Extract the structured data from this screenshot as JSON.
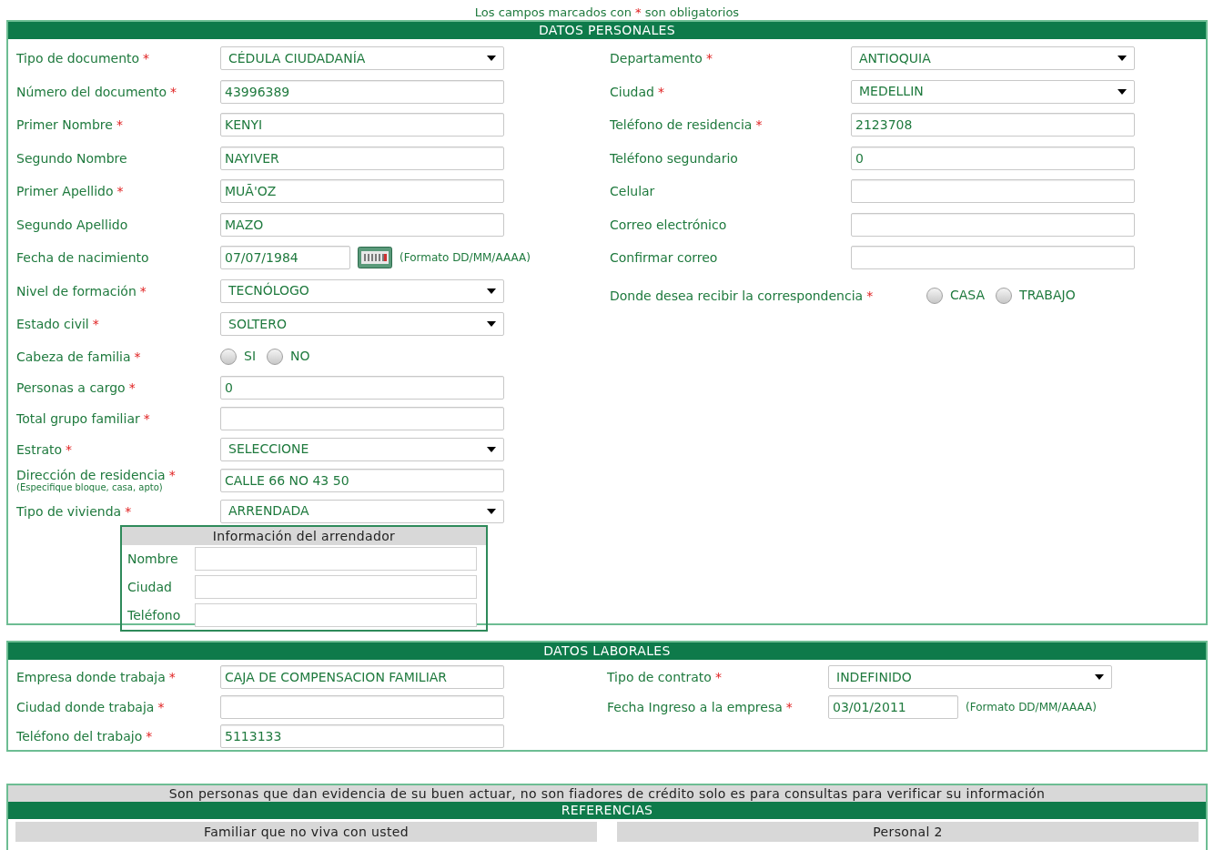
{
  "required_note": {
    "before": "Los campos marcados con",
    "mark": "*",
    "after": "son obligatorios"
  },
  "personal": {
    "title": "DATOS PERSONALES",
    "left": [
      {
        "label": "Tipo de documento",
        "required": true,
        "kind": "select",
        "value": "CÉDULA CIUDADANÍA"
      },
      {
        "label": "Número del documento",
        "required": true,
        "kind": "text",
        "value": "43996389"
      },
      {
        "label": "Primer Nombre",
        "required": true,
        "kind": "text",
        "value": "KENYI"
      },
      {
        "label": "Segundo Nombre",
        "required": false,
        "kind": "text",
        "value": "NAYIVER"
      },
      {
        "label": "Primer Apellido",
        "required": true,
        "kind": "text",
        "value": "MUÃ'OZ"
      },
      {
        "label": "Segundo Apellido",
        "required": false,
        "kind": "text",
        "value": "MAZO"
      },
      {
        "label": "Fecha de nacimiento",
        "required": false,
        "kind": "date",
        "value": "07/07/1984",
        "hint": "(Formato DD/MM/AAAA)"
      },
      {
        "label": "Nivel de formación",
        "required": true,
        "kind": "select",
        "value": "TECNÓLOGO"
      },
      {
        "label": "Estado civil",
        "required": true,
        "kind": "select",
        "value": "SOLTERO"
      },
      {
        "label": "Cabeza de familia",
        "required": true,
        "kind": "radio",
        "options": [
          {
            "label": "SI",
            "selected": false
          },
          {
            "label": "NO",
            "selected": false
          }
        ]
      },
      {
        "label": "Personas a cargo",
        "required": true,
        "kind": "text",
        "value": "0"
      },
      {
        "label": "Total grupo familiar",
        "required": true,
        "kind": "text"
      },
      {
        "label": "Estrato",
        "required": true,
        "kind": "select",
        "value": "SELECCIONE"
      },
      {
        "label": "Dirección de residencia",
        "required": true,
        "kind": "text",
        "value": "CALLE 66 NO 43 50",
        "sublabel": "(Especifique bloque, casa, apto)"
      },
      {
        "label": "Tipo de vivienda",
        "required": true,
        "kind": "select",
        "value": "ARRENDADA"
      }
    ],
    "landlord": {
      "title": "Información del arrendador",
      "fields": [
        {
          "label": "Nombre"
        },
        {
          "label": "Ciudad"
        },
        {
          "label": "Teléfono"
        }
      ]
    },
    "right": [
      {
        "label": "Departamento",
        "required": true,
        "kind": "select",
        "value": "ANTIOQUIA"
      },
      {
        "label": "Ciudad",
        "required": true,
        "kind": "select",
        "value": "MEDELLIN"
      },
      {
        "label": "Teléfono de residencia",
        "required": true,
        "kind": "text",
        "value": "2123708"
      },
      {
        "label": "Teléfono segundario",
        "required": false,
        "kind": "text",
        "value": "0"
      },
      {
        "label": "Celular",
        "required": false,
        "kind": "text"
      },
      {
        "label": "Correo electrónico",
        "required": false,
        "kind": "text"
      },
      {
        "label": "Confirmar correo",
        "required": false,
        "kind": "text"
      },
      {
        "label": "Donde desea recibir la correspondencia",
        "required": true,
        "kind": "radio",
        "options": [
          {
            "label": "CASA",
            "selected": false
          },
          {
            "label": "TRABAJO",
            "selected": false
          }
        ]
      }
    ]
  },
  "laboral": {
    "title": "DATOS LABORALES",
    "left": [
      {
        "label": "Empresa donde trabaja",
        "required": true,
        "kind": "text",
        "value": "CAJA DE COMPENSACION FAMILIAR"
      },
      {
        "label": "Ciudad donde trabaja",
        "required": true,
        "kind": "text"
      },
      {
        "label": "Teléfono del trabajo",
        "required": true,
        "kind": "text",
        "value": "5113133"
      }
    ],
    "right": [
      {
        "label": "Tipo de contrato",
        "required": true,
        "kind": "select",
        "value": "INDEFINIDO"
      },
      {
        "label": "Fecha Ingreso a la empresa",
        "required": true,
        "kind": "datehint",
        "value": "03/01/2011",
        "hint": "(Formato DD/MM/AAAA)"
      }
    ]
  },
  "references": {
    "note": "Son personas que dan evidencia de su buen actuar, no son fiadores de crédito solo es para consultas para verificar su información",
    "title": "REFERENCIAS",
    "columns": [
      "Familiar que no viva con usted",
      "Personal 2"
    ]
  }
}
